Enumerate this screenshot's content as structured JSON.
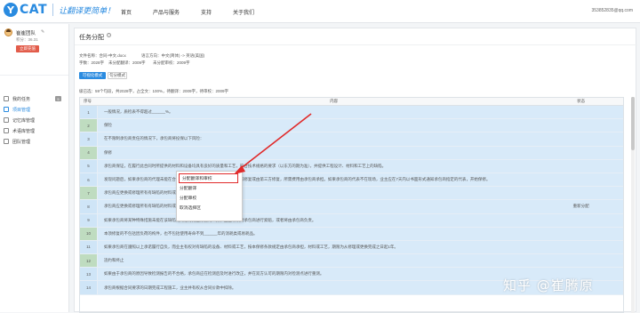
{
  "app": {
    "logo_mark": "Y",
    "logo_text": "CAT",
    "slogan": "让翻译更简单！",
    "nav": [
      "首页",
      "产品与服务",
      "支持",
      "关于我们"
    ],
    "user_id": "353852835@qq.com"
  },
  "sidebar": {
    "name": "崔崔团队",
    "points": "积分：36.31",
    "recharge": "立即充值",
    "items": [
      {
        "label": "我的任务",
        "badge": "5"
      },
      {
        "label": "项目管理",
        "badge": ""
      },
      {
        "label": "记忆库管理",
        "badge": ""
      },
      {
        "label": "术语库管理",
        "badge": ""
      },
      {
        "label": "团队管理",
        "badge": ""
      }
    ],
    "active_index": 1
  },
  "page": {
    "title": "任务分配",
    "help_icon": "?",
    "file_info": "文件名称：合同-中文.docx",
    "language": "语言方向：中文(简体) -> 英语(美国)",
    "words": "字数：2028字",
    "unassigned_translate": "未分配翻译：2009字",
    "unassigned_review": "未分配审校：2009字",
    "btn_sentence": "可视化模式",
    "btn_segment": "句分模式",
    "summary": "级已选：59个句段，共2028字，占全文：100%，待翻译：2009字，待审校：2009字"
  },
  "table": {
    "headers": {
      "no": "序号",
      "content": "内容",
      "status": "状态",
      "op": ""
    },
    "rows": [
      {
        "no": "1",
        "content": "一般情况，质检表不得超过______%。",
        "status": ""
      },
      {
        "no": "2",
        "content": "保险",
        "status": ""
      },
      {
        "no": "3",
        "content": "在不限制承包商责任的情况下，承包商将投保以下风险：",
        "status": ""
      },
      {
        "no": "4",
        "content": "保修",
        "status": ""
      },
      {
        "no": "5",
        "content": "承包商保证，在履行此合同时所提供的材料和设备均具有良好的质量和工艺，符合技术规格的要求（以东方的期为准），并提供工程设计、材料和工艺上的缺陷。",
        "status": ""
      },
      {
        "no": "6",
        "content": "发现问题后，如果承包商的代理未能在合理时间内修复缺陷，将由业主自行安排修复或由第三方修复，所需费用由承包商承担。如果承包商的代表不在现场，业主应在7天内以书面形式通知承包商指定的代表，开始保修。",
        "status": ""
      },
      {
        "no": "7",
        "content": "承包商应更换或修理所有有缺陷的材料或设备。",
        "status": ""
      },
      {
        "no": "8",
        "content": "承包商应更换或修理所有有缺陷的材料或设备，并承担由此产生的运输费用。",
        "status": "重新分配"
      },
      {
        "no": "9",
        "content": "如果承包商将某种特殊措施未能在该缺陷期内进行完全修复的义务，业主有权对承包商进行索赔，或者将由承包商负责。",
        "status": ""
      },
      {
        "no": "10",
        "content": "本须修复的不包括因负荷的构件，也不包括使用寿命不到______年的消耗类或易耗品。",
        "status": ""
      },
      {
        "no": "11",
        "content": "如果承包商在遵照以上承诺履行自负，而业主有权对有缺陷的设备、材料或工艺，按本保修条款规定由承包商承担，材料或工艺，期限为从修理或更换完成之日起1年。",
        "status": ""
      },
      {
        "no": "12",
        "content": "违约和终止",
        "status": ""
      },
      {
        "no": "13",
        "content": "如果由于承包商的原因导致检测报告的不合格，承包商应在检测后及时进行改正，并在双方认可的期限内对检测点进行重测。",
        "status": ""
      },
      {
        "no": "14",
        "content": "承包商根据合同要求的日期完成工程施工，业主并有权从合同价款中扣除。",
        "status": ""
      }
    ]
  },
  "context_menu": {
    "items": [
      "分配翻译和审校",
      "分配翻译",
      "分配审校",
      "取消选择区"
    ]
  },
  "watermark": "知乎 @崔腾原",
  "colors": {
    "accent": "#2a8be0",
    "highlight_row": "#d8eaf9",
    "alert_red": "#e02a2a"
  }
}
